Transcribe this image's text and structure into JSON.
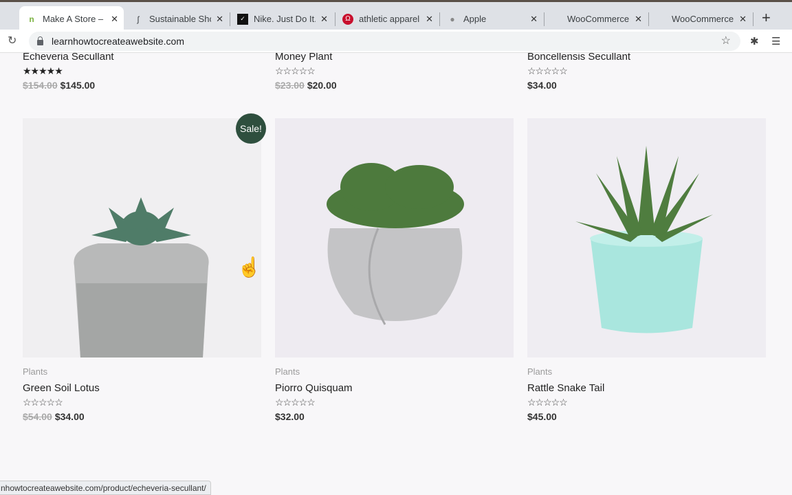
{
  "browser": {
    "tabs": [
      {
        "label": "Make A Store – L",
        "icon": "n-favicon",
        "active": true
      },
      {
        "label": "Sustainable Sho",
        "icon": "allbirds-icon"
      },
      {
        "label": "Nike. Just Do It.",
        "icon": "nike-icon"
      },
      {
        "label": "athletic apparel",
        "icon": "lululemon-icon"
      },
      {
        "label": "Apple",
        "icon": "apple-icon"
      },
      {
        "label": "WooCommerce",
        "icon": "none"
      },
      {
        "label": "WooCommerce",
        "icon": "none"
      }
    ],
    "close_glyph": "✕",
    "new_tab": "+",
    "url": "learnhowtocreateawebsite.com",
    "status_url": "nhowtocreateawebsite.com/product/echeveria-secullant/"
  },
  "products_top": [
    {
      "title": "Echeveria Secullant",
      "rating": 5,
      "old_price": "$154.00",
      "price": "$145.00"
    },
    {
      "title": "Money Plant",
      "rating": 0,
      "old_price": "$23.00",
      "price": "$20.00"
    },
    {
      "title": "Boncellensis Secullant",
      "rating": 0,
      "old_price": "",
      "price": "$34.00"
    }
  ],
  "products": [
    {
      "category": "Plants",
      "title": "Green Soil Lotus",
      "rating": 0,
      "old_price": "$54.00",
      "price": "$34.00",
      "sale": "Sale!"
    },
    {
      "category": "Plants",
      "title": "Piorro Quisquam",
      "rating": 0,
      "old_price": "",
      "price": "$32.00"
    },
    {
      "category": "Plants",
      "title": "Rattle Snake Tail",
      "rating": 0,
      "old_price": "",
      "price": "$45.00"
    }
  ],
  "stars_full": "★★★★★",
  "stars_empty": "☆☆☆☆☆",
  "colors": {
    "sale_badge": "#2e4f3e",
    "pot_mint": "#a9e6de"
  }
}
